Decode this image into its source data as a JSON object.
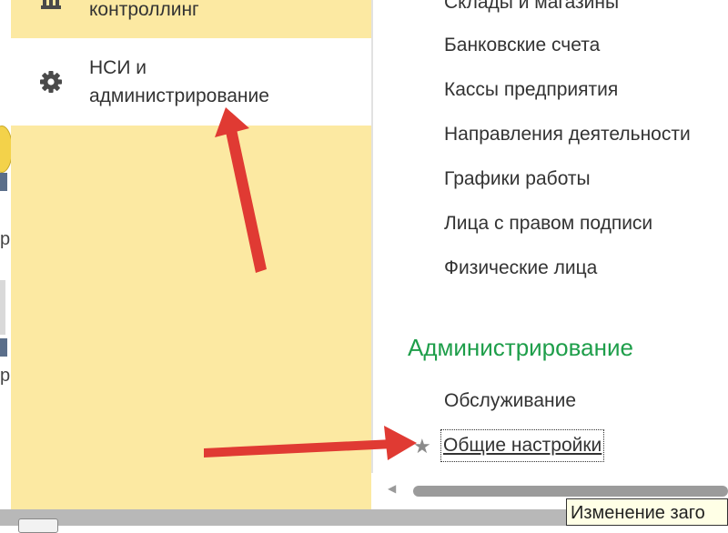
{
  "sidebar": {
    "items": [
      {
        "label": "контроллинг",
        "icon": "building-icon"
      },
      {
        "label_line1": "НСИ и",
        "label_line2": "администрирование",
        "icon": "gear-icon",
        "active": true
      }
    ]
  },
  "content": {
    "links": [
      "Склады и магазины",
      "Банковские счета",
      "Кассы предприятия",
      "Направления деятельности",
      "Графики работы",
      "Лица с правом подписи",
      "Физические лица"
    ],
    "admin_section": {
      "title": "Администрирование",
      "links": [
        "Обслуживание",
        "Общие настройки"
      ]
    }
  },
  "left_strip": {
    "fragment": "р"
  },
  "tooltip": {
    "text": "Изменение заго"
  },
  "colors": {
    "sidebar_bg": "#fce9a2",
    "section_title": "#1e9e4a",
    "annotation_arrow": "#e03a33"
  }
}
